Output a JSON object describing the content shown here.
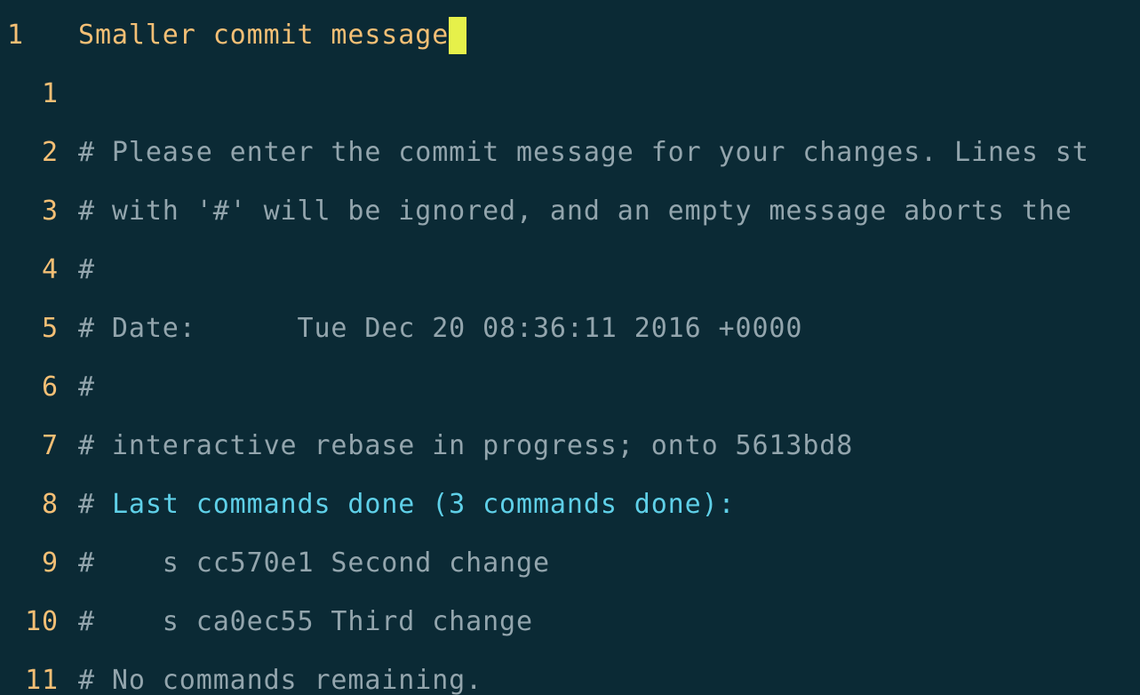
{
  "editor": {
    "current_line_number": "1",
    "current_line_text": "Smaller commit message",
    "lines": [
      {
        "number": "1",
        "text": ""
      },
      {
        "number": "2",
        "text": "# Please enter the commit message for your changes. Lines st"
      },
      {
        "number": "3",
        "text": "# with '#' will be ignored, and an empty message aborts the"
      },
      {
        "number": "4",
        "text": "#"
      },
      {
        "number": "5",
        "text": "# Date:      Tue Dec 20 08:36:11 2016 +0000"
      },
      {
        "number": "6",
        "text": "#"
      },
      {
        "number": "7",
        "text": "# interactive rebase in progress; onto 5613bd8"
      },
      {
        "number": "8",
        "hash": "# ",
        "highlight": "Last commands done (3 commands done):"
      },
      {
        "number": "9",
        "text": "#    s cc570e1 Second change"
      },
      {
        "number": "10",
        "text": "#    s ca0ec55 Third change"
      },
      {
        "number": "11",
        "text": "# No commands remaining."
      }
    ]
  },
  "colors": {
    "background": "#0b2a35",
    "line_number": "#f4bf75",
    "comment_text": "#93a5ad",
    "highlight_text": "#5fd0e8",
    "cursor": "#e6f04a"
  }
}
